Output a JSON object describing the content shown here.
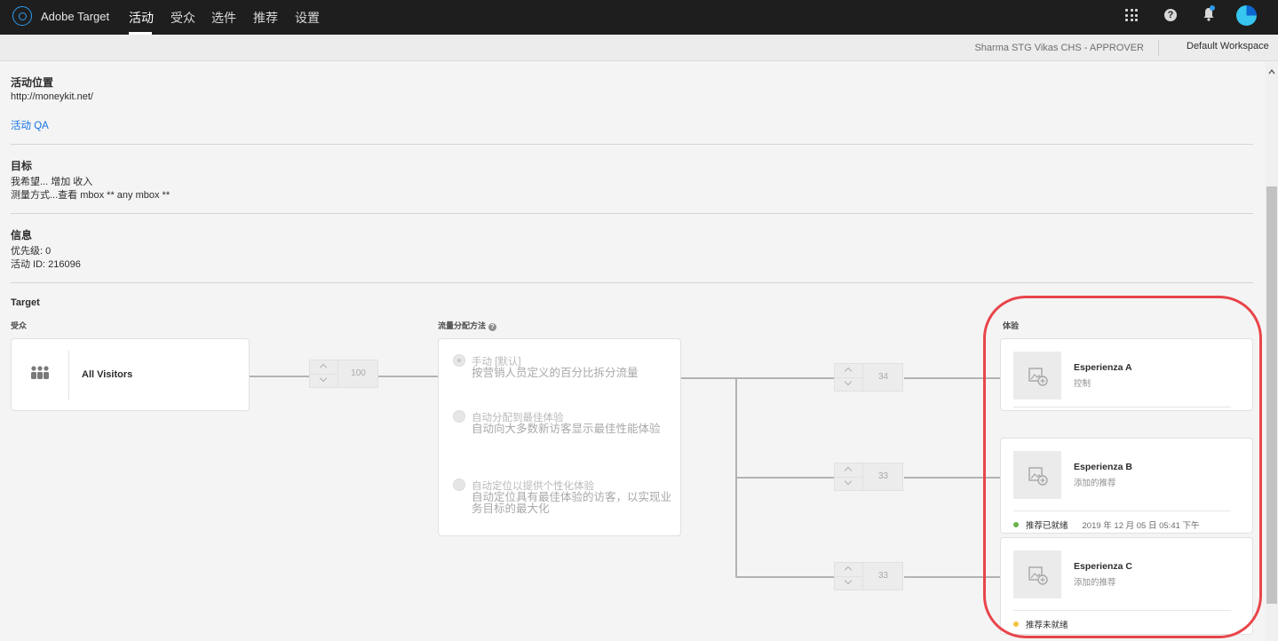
{
  "app": {
    "name": "Adobe Target"
  },
  "nav": {
    "items": [
      "活动",
      "受众",
      "选件",
      "推荐",
      "设置"
    ],
    "active_index": 0
  },
  "header_icons": [
    "apps-grid-icon",
    "help-icon",
    "notification-bell-icon",
    "user-avatar"
  ],
  "subbar": {
    "user_role": "Sharma STG Vikas CHS - APPROVER",
    "workspace": "Default Workspace"
  },
  "location": {
    "title": "活动位置",
    "url": "http://moneykit.net/",
    "qa_link": "活动 QA"
  },
  "goal": {
    "title": "目标",
    "line1": "我希望...   增加 收入",
    "line2": "测量方式...查看 mbox ** any mbox **"
  },
  "info": {
    "title": "信息",
    "priority": "优先级: 0",
    "activity_id": "活动 ID: 216096"
  },
  "target": {
    "title": "Target",
    "audience_label": "受众",
    "traffic_label": "流量分配方法",
    "experience_label": "体验",
    "audience": {
      "name": "All Visitors",
      "allocation": "100"
    },
    "methods": [
      {
        "title": "手动 [默认]",
        "desc": "按营销人员定义的百分比拆分流量",
        "checked": true
      },
      {
        "title": "自动分配到最佳体验",
        "desc": "自动向大多数新访客显示最佳性能体验",
        "checked": false
      },
      {
        "title": "自动定位以提供个性化体验",
        "desc": "自动定位具有最佳体验的访客，以实现业务目标的最大化",
        "checked": false
      }
    ],
    "experiences": [
      {
        "name": "Esperienza A",
        "sub": "控制",
        "allocation": "34",
        "status": "",
        "status_time": ""
      },
      {
        "name": "Esperienza B",
        "sub": "添加的推荐",
        "allocation": "33",
        "status": "推荐已就绪",
        "status_time": "2019 年 12 月 05 日 05:41 下午",
        "status_color": "#6ab04c"
      },
      {
        "name": "Esperienza C",
        "sub": "添加的推荐",
        "allocation": "33",
        "status": "推荐未就绪",
        "status_time": "",
        "status_color": "#f5c242"
      }
    ]
  },
  "colors": {
    "topbar": "#1e1e1e",
    "link": "#1473e6",
    "highlight": "#e8454a"
  }
}
